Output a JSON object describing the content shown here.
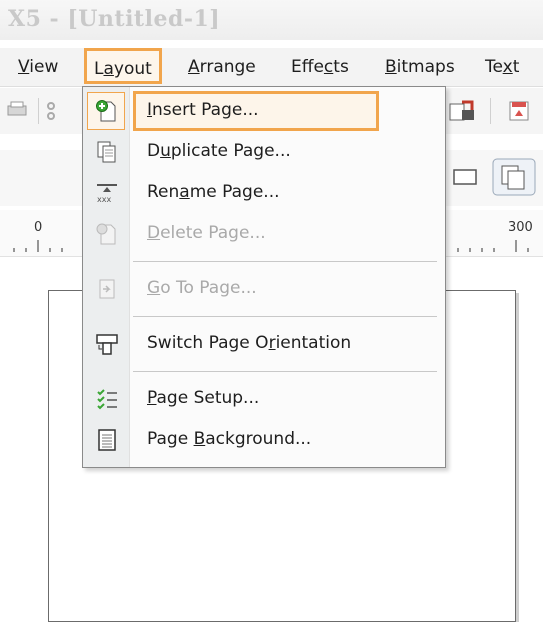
{
  "window": {
    "title": "X5 - [Untitled-1]"
  },
  "menubar": {
    "items": [
      {
        "label": "View"
      },
      {
        "label": "Layout",
        "active": true
      },
      {
        "label": "Arrange"
      },
      {
        "label": "Effects"
      },
      {
        "label": "Bitmaps"
      },
      {
        "label": "Text"
      }
    ]
  },
  "ruler": {
    "left_tick": "0",
    "right_tick": "300"
  },
  "layout_menu": {
    "items": [
      {
        "label": "Insert Page...",
        "icon": "insert-page-icon",
        "enabled": true,
        "highlighted": true
      },
      {
        "label": "Duplicate Page...",
        "icon": "duplicate-page-icon",
        "enabled": true
      },
      {
        "label": "Rename Page...",
        "icon": "rename-page-icon",
        "enabled": true
      },
      {
        "label": "Delete Page...",
        "icon": "delete-page-icon",
        "enabled": false
      },
      {
        "label": "Go To Page...",
        "icon": "go-to-page-icon",
        "enabled": false
      },
      {
        "label": "Switch Page Orientation",
        "icon": "switch-orientation-icon",
        "enabled": true
      },
      {
        "label": "Page Setup...",
        "icon": "page-setup-icon",
        "enabled": true
      },
      {
        "label": "Page Background...",
        "icon": "page-background-icon",
        "enabled": true
      }
    ]
  },
  "colors": {
    "highlight": "#f1a54c",
    "disabled_text": "#a9a9a9"
  }
}
